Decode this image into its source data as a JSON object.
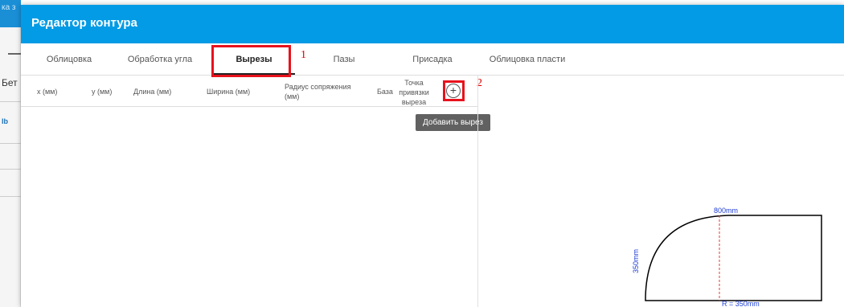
{
  "background": {
    "top_text": "ка з",
    "side_text": "Бет",
    "side_link": "lb"
  },
  "dialog": {
    "title": "Редактор контура"
  },
  "tabs": [
    {
      "label": "Облицовка",
      "active": false
    },
    {
      "label": "Обработка угла",
      "active": false
    },
    {
      "label": "Вырезы",
      "active": true
    },
    {
      "label": "Пазы",
      "active": false
    },
    {
      "label": "Присадка",
      "active": false
    },
    {
      "label": "Облицовка пласти",
      "active": false
    }
  ],
  "annotations": {
    "marker_1": "1",
    "marker_2": "2"
  },
  "table": {
    "columns": {
      "x": "x (мм)",
      "y": "y (мм)",
      "length": "Длина (мм)",
      "width": "Ширина (мм)",
      "radius_line1": "Радиус сопряжения",
      "radius_line2": "(мм)",
      "base": "База",
      "anchor_line1": "Точка",
      "anchor_line2": "привязки",
      "anchor_line3": "выреза"
    },
    "add_icon": "plus-circle-icon",
    "add_glyph": "+",
    "tooltip": "Добавить вырез"
  },
  "diagram": {
    "width_label": "800mm",
    "height_label": "350mm",
    "radius_label": "R = 350mm",
    "line_color": "#000000",
    "dim_color": "#e53935",
    "label_color": "#1e3ed6"
  },
  "colors": {
    "header": "#039be5",
    "highlight": "#e8121c",
    "tooltip_bg": "#616161"
  }
}
